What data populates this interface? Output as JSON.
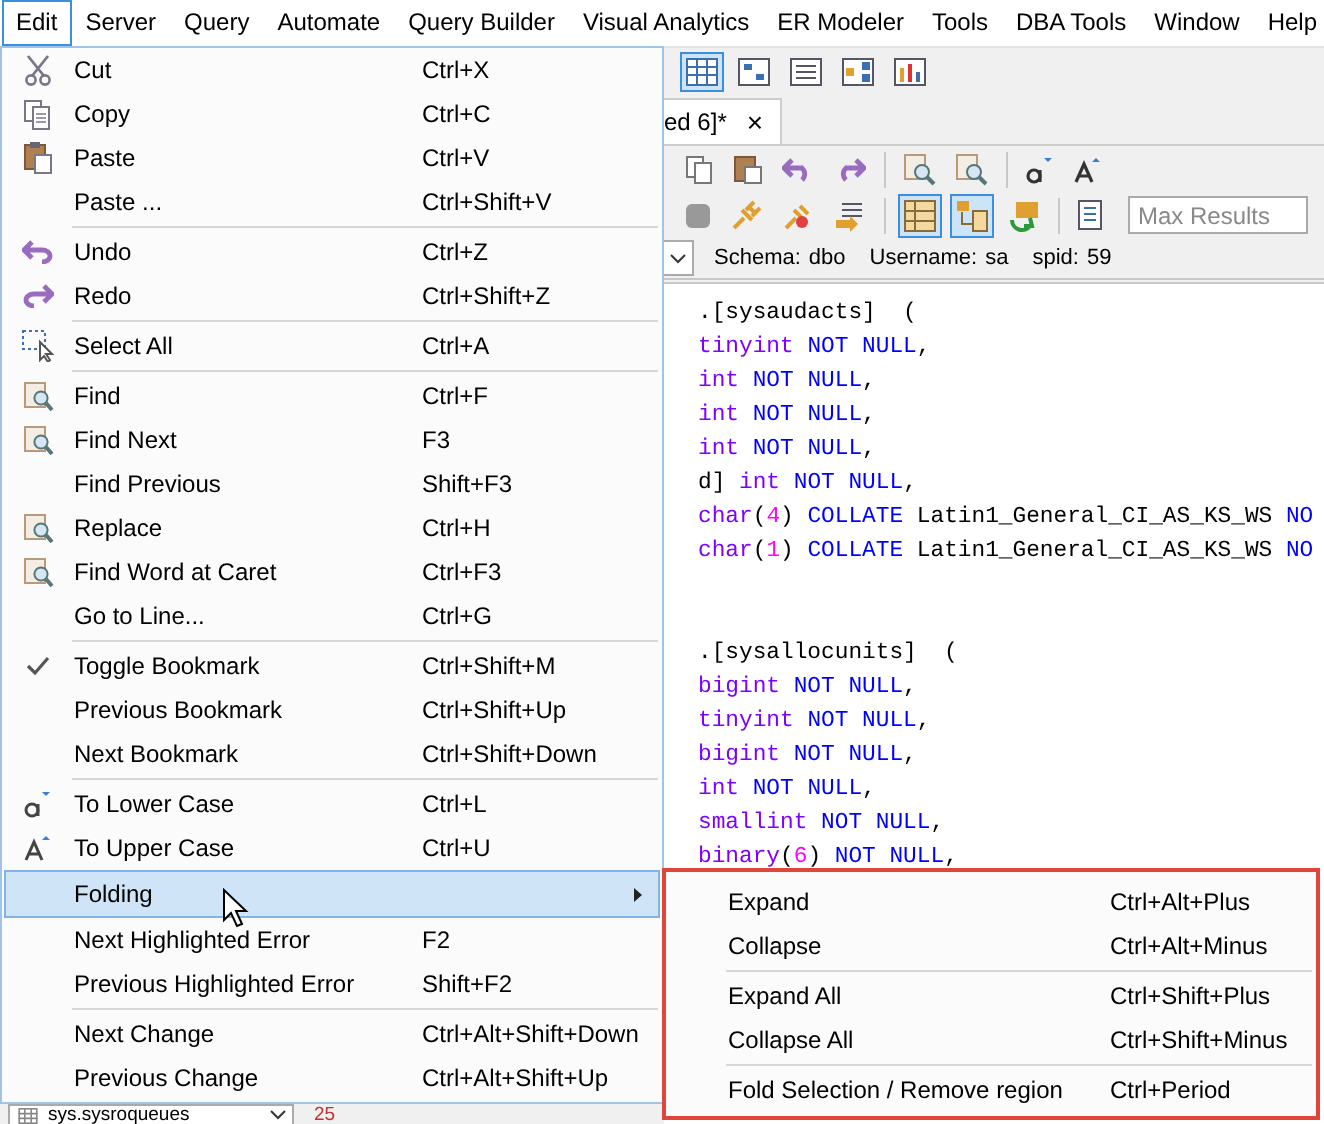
{
  "menubar": [
    {
      "label": "Edit",
      "selected": true
    },
    {
      "label": "Server",
      "selected": false
    },
    {
      "label": "Query",
      "selected": false
    },
    {
      "label": "Automate",
      "selected": false
    },
    {
      "label": "Query Builder",
      "selected": false
    },
    {
      "label": "Visual Analytics",
      "selected": false
    },
    {
      "label": "ER Modeler",
      "selected": false
    },
    {
      "label": "Tools",
      "selected": false
    },
    {
      "label": "DBA Tools",
      "selected": false
    },
    {
      "label": "Window",
      "selected": false
    },
    {
      "label": "Help",
      "selected": false
    }
  ],
  "editor_tab": {
    "label": "ed 6]*",
    "close": "×"
  },
  "max_results": {
    "placeholder": "Max Results"
  },
  "connection_info": [
    {
      "label": "Schema:",
      "value": "dbo"
    },
    {
      "label": "Username:",
      "value": "sa"
    },
    {
      "label": "spid:",
      "value": "59"
    }
  ],
  "code_blocks": [
    [
      [
        {
          "kind": "plain",
          "text": ".[sysaudacts]  ("
        }
      ],
      [
        {
          "kind": "type",
          "text": "tinyint"
        },
        {
          "kind": "keyword",
          "text": " NOT NULL"
        },
        {
          "kind": "plain",
          "text": ","
        }
      ],
      [
        {
          "kind": "type",
          "text": "int"
        },
        {
          "kind": "keyword",
          "text": " NOT NULL"
        },
        {
          "kind": "plain",
          "text": ","
        }
      ],
      [
        {
          "kind": "type",
          "text": "int"
        },
        {
          "kind": "keyword",
          "text": " NOT NULL"
        },
        {
          "kind": "plain",
          "text": ","
        }
      ],
      [
        {
          "kind": "type",
          "text": "int"
        },
        {
          "kind": "keyword",
          "text": " NOT NULL"
        },
        {
          "kind": "plain",
          "text": ","
        }
      ],
      [
        {
          "kind": "plain",
          "text": "d] "
        },
        {
          "kind": "type",
          "text": "int"
        },
        {
          "kind": "keyword",
          "text": " NOT NULL"
        },
        {
          "kind": "plain",
          "text": ","
        }
      ],
      [
        {
          "kind": "type",
          "text": "char"
        },
        {
          "kind": "plain",
          "text": "("
        },
        {
          "kind": "number",
          "text": "4"
        },
        {
          "kind": "plain",
          "text": ") "
        },
        {
          "kind": "keyword",
          "text": "COLLATE"
        },
        {
          "kind": "plain",
          "text": " Latin1_General_CI_AS_KS_WS "
        },
        {
          "kind": "keyword",
          "text": "NO"
        }
      ],
      [
        {
          "kind": "type",
          "text": "char"
        },
        {
          "kind": "plain",
          "text": "("
        },
        {
          "kind": "number",
          "text": "1"
        },
        {
          "kind": "plain",
          "text": ") "
        },
        {
          "kind": "keyword",
          "text": "COLLATE"
        },
        {
          "kind": "plain",
          "text": " Latin1_General_CI_AS_KS_WS "
        },
        {
          "kind": "keyword",
          "text": "NO"
        }
      ]
    ],
    [
      [
        {
          "kind": "plain",
          "text": ".[sysallocunits]  ("
        }
      ],
      [
        {
          "kind": "type",
          "text": "bigint"
        },
        {
          "kind": "keyword",
          "text": " NOT NULL"
        },
        {
          "kind": "plain",
          "text": ","
        }
      ],
      [
        {
          "kind": "type",
          "text": "tinyint"
        },
        {
          "kind": "keyword",
          "text": " NOT NULL"
        },
        {
          "kind": "plain",
          "text": ","
        }
      ],
      [
        {
          "kind": "type",
          "text": "bigint"
        },
        {
          "kind": "keyword",
          "text": " NOT NULL"
        },
        {
          "kind": "plain",
          "text": ","
        }
      ],
      [
        {
          "kind": "type",
          "text": "int"
        },
        {
          "kind": "keyword",
          "text": " NOT NULL"
        },
        {
          "kind": "plain",
          "text": ","
        }
      ],
      [
        {
          "kind": "type",
          "text": "smallint"
        },
        {
          "kind": "keyword",
          "text": " NOT NULL"
        },
        {
          "kind": "plain",
          "text": ","
        }
      ],
      [
        {
          "kind": "type",
          "text": "binary"
        },
        {
          "kind": "plain",
          "text": "("
        },
        {
          "kind": "number",
          "text": "6"
        },
        {
          "kind": "plain",
          "text": ") "
        },
        {
          "kind": "keyword",
          "text": "NOT NULL"
        },
        {
          "kind": "plain",
          "text": ","
        }
      ]
    ]
  ],
  "bottom_bar": {
    "object_name": "sys.sysroqueues",
    "value": "25"
  },
  "edit_menu": [
    {
      "kind": "item",
      "label": "Cut",
      "shortcut": "Ctrl+X",
      "selected": false
    },
    {
      "kind": "item",
      "label": "Copy",
      "shortcut": "Ctrl+C",
      "selected": false
    },
    {
      "kind": "item",
      "label": "Paste",
      "shortcut": "Ctrl+V",
      "selected": false
    },
    {
      "kind": "item",
      "label": "Paste ...",
      "shortcut": "Ctrl+Shift+V",
      "selected": false
    },
    {
      "kind": "separator"
    },
    {
      "kind": "item",
      "label": "Undo",
      "shortcut": "Ctrl+Z",
      "selected": false
    },
    {
      "kind": "item",
      "label": "Redo",
      "shortcut": "Ctrl+Shift+Z",
      "selected": false
    },
    {
      "kind": "separator"
    },
    {
      "kind": "item",
      "label": "Select All",
      "shortcut": "Ctrl+A",
      "selected": false
    },
    {
      "kind": "separator"
    },
    {
      "kind": "item",
      "label": "Find",
      "shortcut": "Ctrl+F",
      "selected": false
    },
    {
      "kind": "item",
      "label": "Find Next",
      "shortcut": "F3",
      "selected": false
    },
    {
      "kind": "item",
      "label": "Find Previous",
      "shortcut": "Shift+F3",
      "selected": false
    },
    {
      "kind": "item",
      "label": "Replace",
      "shortcut": "Ctrl+H",
      "selected": false
    },
    {
      "kind": "item",
      "label": "Find Word at Caret",
      "shortcut": "Ctrl+F3",
      "selected": false
    },
    {
      "kind": "item",
      "label": "Go to Line...",
      "shortcut": "Ctrl+G",
      "selected": false
    },
    {
      "kind": "separator"
    },
    {
      "kind": "item",
      "label": "Toggle Bookmark",
      "shortcut": "Ctrl+Shift+M",
      "selected": false
    },
    {
      "kind": "item",
      "label": "Previous Bookmark",
      "shortcut": "Ctrl+Shift+Up",
      "selected": false
    },
    {
      "kind": "item",
      "label": "Next Bookmark",
      "shortcut": "Ctrl+Shift+Down",
      "selected": false
    },
    {
      "kind": "separator"
    },
    {
      "kind": "item",
      "label": "To Lower Case",
      "shortcut": "Ctrl+L",
      "selected": false
    },
    {
      "kind": "item",
      "label": "To Upper Case",
      "shortcut": "Ctrl+U",
      "selected": false
    },
    {
      "kind": "submenu",
      "label": "Folding",
      "selected": true
    },
    {
      "kind": "item",
      "label": "Next Highlighted Error",
      "shortcut": "F2",
      "selected": false
    },
    {
      "kind": "item",
      "label": "Previous Highlighted Error",
      "shortcut": "Shift+F2",
      "selected": false
    },
    {
      "kind": "separator"
    },
    {
      "kind": "item",
      "label": "Next Change",
      "shortcut": "Ctrl+Alt+Shift+Down",
      "selected": false
    },
    {
      "kind": "item",
      "label": "Previous Change",
      "shortcut": "Ctrl+Alt+Shift+Up",
      "selected": false
    }
  ],
  "folding_submenu": [
    {
      "kind": "item",
      "label": "Expand",
      "shortcut": "Ctrl+Alt+Plus"
    },
    {
      "kind": "item",
      "label": "Collapse",
      "shortcut": "Ctrl+Alt+Minus"
    },
    {
      "kind": "separator"
    },
    {
      "kind": "item",
      "label": "Expand All",
      "shortcut": "Ctrl+Shift+Plus"
    },
    {
      "kind": "item",
      "label": "Collapse All",
      "shortcut": "Ctrl+Shift+Minus"
    },
    {
      "kind": "separator"
    },
    {
      "kind": "item",
      "label": "Fold Selection / Remove region",
      "shortcut": "Ctrl+Period"
    }
  ]
}
